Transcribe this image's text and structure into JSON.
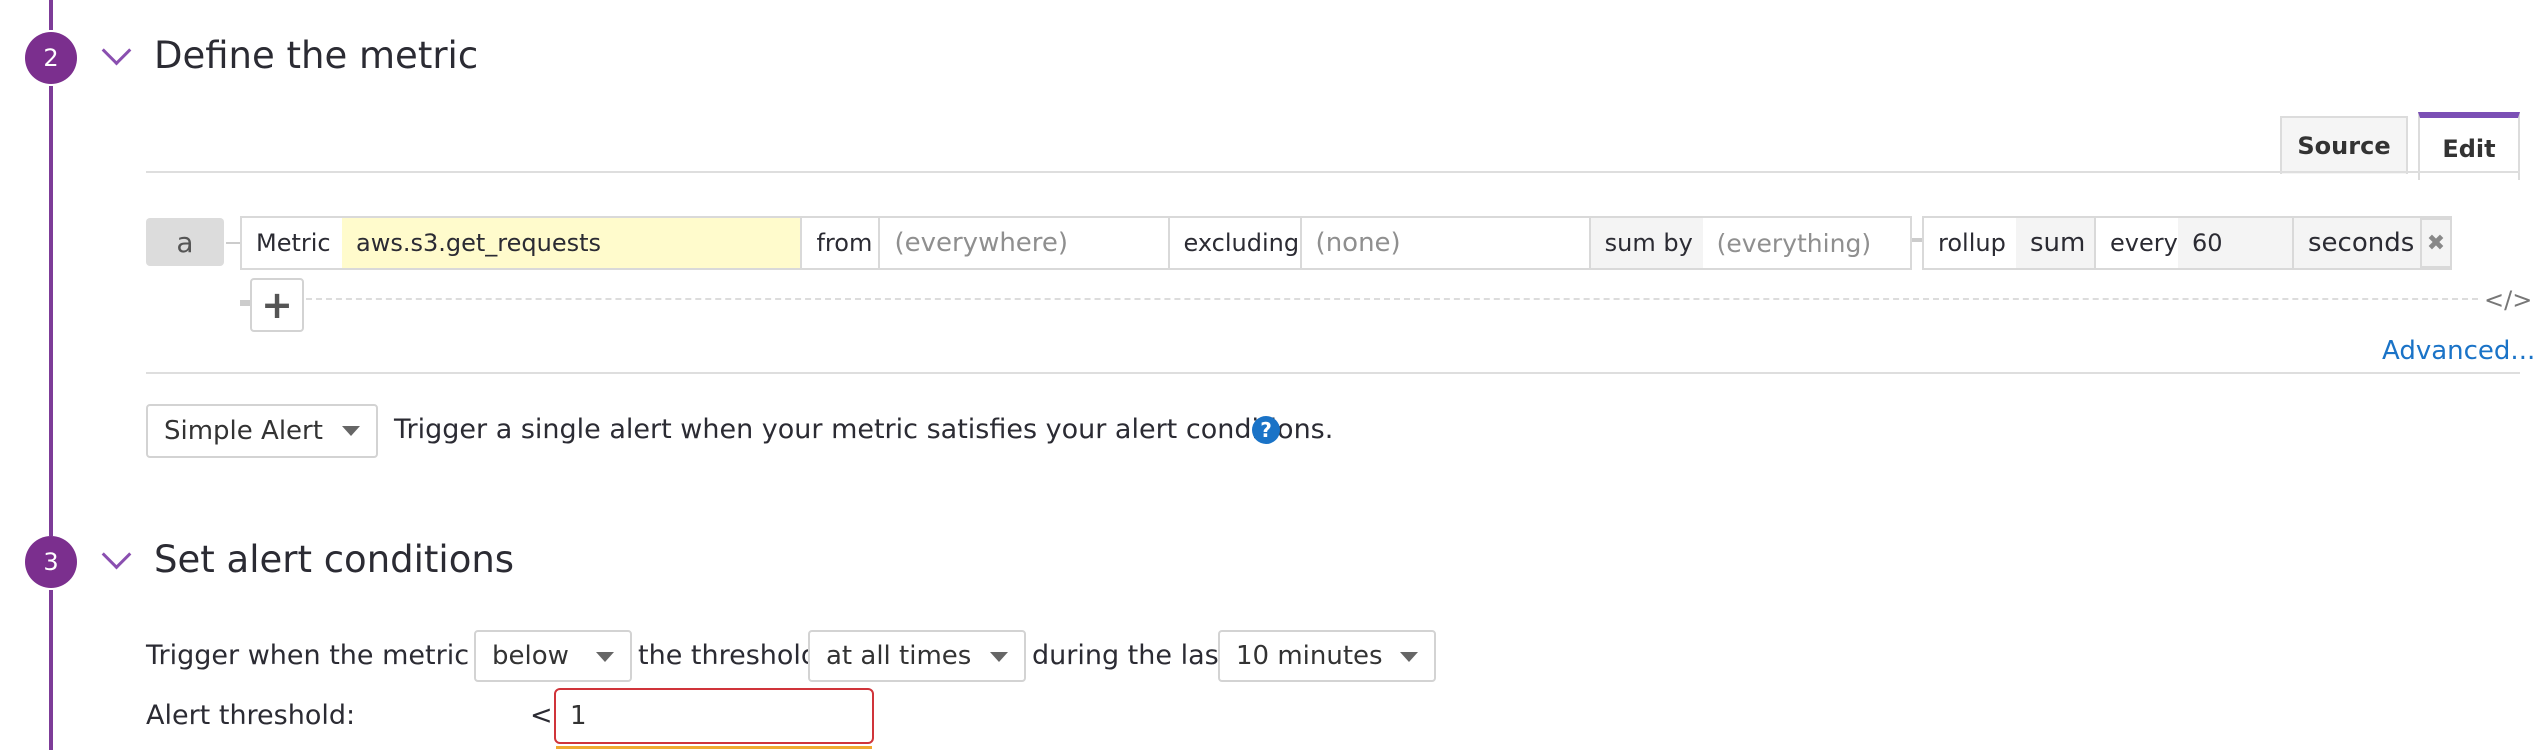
{
  "section2": {
    "number": "2",
    "title": "Define the metric"
  },
  "tabs": {
    "source": "Source",
    "edit": "Edit"
  },
  "query": {
    "row_label": "a",
    "metric_label": "Metric",
    "metric_value": "aws.s3.get_requests",
    "from_label": "from",
    "from_placeholder": "(everywhere)",
    "excluding_label": "excluding",
    "excluding_placeholder": "(none)",
    "sumby_label": "sum by",
    "sumby_placeholder": "(everything)",
    "rollup_label": "rollup",
    "rollup_value": "sum",
    "every_label": "every",
    "every_value": "60",
    "unit": "seconds",
    "close_glyph": "✖",
    "add_glyph": "+",
    "code_glyph": "</>"
  },
  "advanced_link": "Advanced...",
  "alert_type": {
    "selected": "Simple Alert",
    "description": "Trigger a single alert when your metric satisfies your alert conditions.",
    "help_glyph": "?"
  },
  "section3": {
    "number": "3",
    "title": "Set alert conditions"
  },
  "conditions": {
    "prefix": "Trigger when the metric is",
    "comparator": "below",
    "mid": "the threshold",
    "occurrence": "at all times",
    "during": "during the last",
    "window": "10 minutes"
  },
  "threshold": {
    "label": "Alert threshold:",
    "operator": "<",
    "value": "1"
  },
  "colors": {
    "accent": "#7b2f8e",
    "link": "#1a73c7",
    "metric_bg": "#fffbcc",
    "error_border": "#d0343a"
  }
}
